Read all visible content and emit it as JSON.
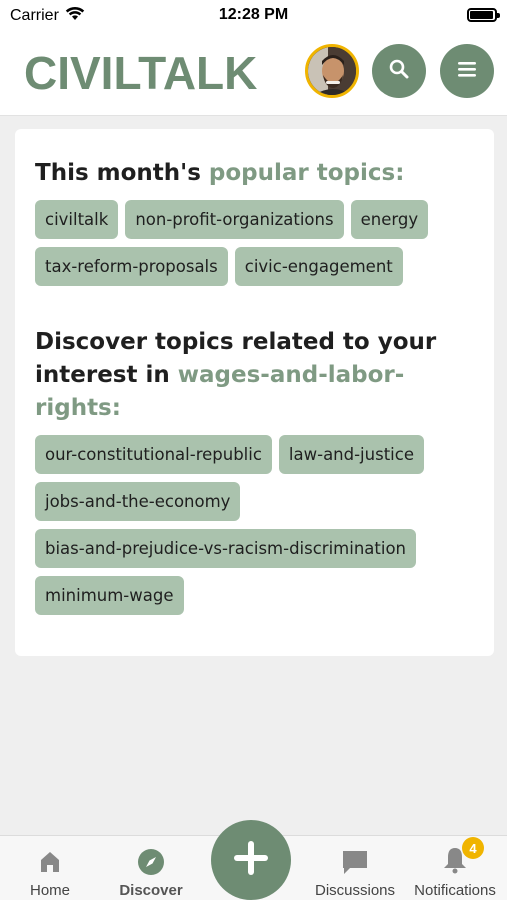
{
  "status_bar": {
    "carrier": "Carrier",
    "time": "12:28 PM",
    "battery_level": 0.95
  },
  "header": {
    "logo": "CIVILTALK"
  },
  "popular": {
    "title_prefix": "This month's ",
    "title_accent": "popular topics:",
    "tags": [
      "civiltalk",
      "non-profit-organizations",
      "energy",
      "tax-reform-proposals",
      "civic-engagement"
    ]
  },
  "related": {
    "title_prefix": "Discover topics related to your interest in ",
    "title_accent": "wages-and-labor-rights:",
    "tags": [
      "our-constitutional-republic",
      "law-and-justice",
      "jobs-and-the-economy",
      "bias-and-prejudice-vs-racism-discrimination",
      "minimum-wage"
    ]
  },
  "nav": {
    "home": "Home",
    "discover": "Discover",
    "discussions": "Discussions",
    "notifications": "Notifications",
    "notifications_count": "4"
  },
  "colors": {
    "brand": "#6e8c73",
    "accent_text": "#7f9a83",
    "tag_bg": "#aac2ad",
    "badge": "#f0b400"
  },
  "icons": [
    "wifi-icon",
    "search-icon",
    "hamburger-menu-icon",
    "home-icon",
    "compass-icon",
    "plus-icon",
    "chat-bubble-icon",
    "bell-icon"
  ]
}
